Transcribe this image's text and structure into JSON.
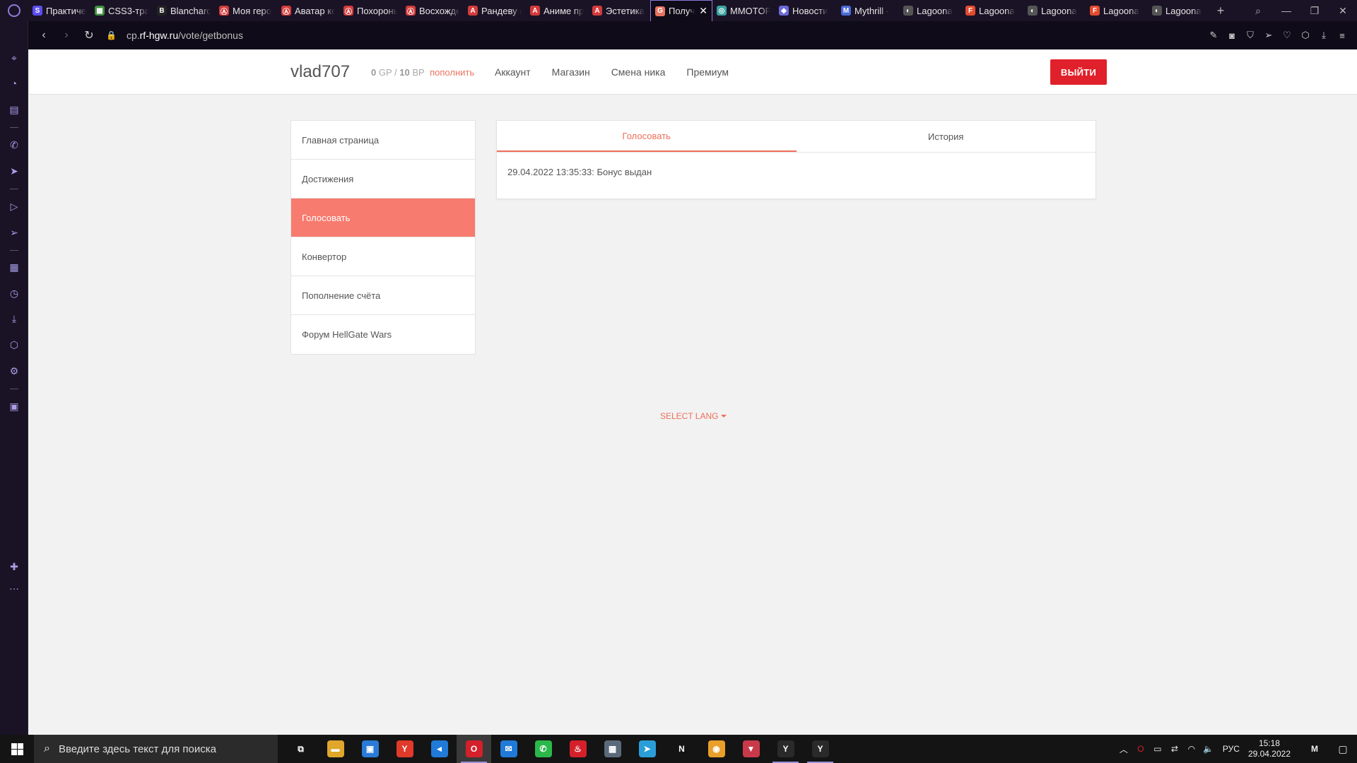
{
  "browser": {
    "tabs": [
      {
        "label": "Практиче",
        "favicon": "S",
        "color": "#5b4ef0"
      },
      {
        "label": "CSS3-тра",
        "favicon": "▦",
        "color": "#3c8f3c"
      },
      {
        "label": "Blanchard",
        "favicon": "B",
        "color": "#222222"
      },
      {
        "label": "Моя геро",
        "favicon": "Ⓐ",
        "color": "#d33a3a"
      },
      {
        "label": "Аватар ко",
        "favicon": "Ⓐ",
        "color": "#d33a3a"
      },
      {
        "label": "Похороны",
        "favicon": "Ⓐ",
        "color": "#d33a3a"
      },
      {
        "label": "Восхожде",
        "favicon": "Ⓐ",
        "color": "#d33a3a"
      },
      {
        "label": "Рандеву с",
        "favicon": "A",
        "color": "#d33a3a"
      },
      {
        "label": "Аниме пр",
        "favicon": "A",
        "color": "#d33a3a"
      },
      {
        "label": "Эстетика",
        "favicon": "A",
        "color": "#d33a3a"
      },
      {
        "label": "Получ",
        "favicon": "G",
        "color": "#e8735f",
        "active": true
      },
      {
        "label": "MMOTOP",
        "favicon": "◎",
        "color": "#3aa3a3"
      },
      {
        "label": "Новости",
        "favicon": "◆",
        "color": "#6a6ad8"
      },
      {
        "label": "Mythrill -",
        "favicon": "M",
        "color": "#4a6ad8"
      },
      {
        "label": "Lagoona",
        "favicon": "◐",
        "color": "#555555"
      },
      {
        "label": "Lagoona",
        "favicon": "F",
        "color": "#e34a2e"
      },
      {
        "label": "Lagoona",
        "favicon": "◐",
        "color": "#555555"
      },
      {
        "label": "Lagoona",
        "favicon": "F",
        "color": "#e34a2e"
      },
      {
        "label": "Lagoona",
        "favicon": "◐",
        "color": "#555555"
      }
    ],
    "close_glyph": "✕",
    "new_tab_glyph": "+",
    "url_host_prefix": "cp.",
    "url_host_main": "rf-hgw.ru",
    "url_path": "/vote/getbonus"
  },
  "site": {
    "username": "vlad707",
    "balance_gp_value": "0",
    "balance_gp_unit": "GP",
    "balance_sep": "/",
    "balance_bp_value": "10",
    "balance_bp_unit": "BP",
    "topup_link": "пополнить",
    "nav": [
      "Аккаунт",
      "Магазин",
      "Смена ника",
      "Премиум"
    ],
    "logout_label": "ВЫЙТИ",
    "menu": [
      "Главная страница",
      "Достижения",
      "Голосовать",
      "Конвертор",
      "Пополнение счёта",
      "Форум HellGate Wars"
    ],
    "active_menu_index": 2,
    "panel_tabs": [
      "Голосовать",
      "История"
    ],
    "panel_message": "29.04.2022 13:35:33: Бонус выдан",
    "select_lang": "SELECT LANG",
    "accent_color": "#f77b6e",
    "logout_color": "#e0202a"
  },
  "taskbar": {
    "search_placeholder": "Введите здесь текст для поиска",
    "apps": [
      {
        "name": "task-view",
        "glyph": "⧉",
        "color": "#141414"
      },
      {
        "name": "file-explorer",
        "glyph": "▬",
        "color": "#e0a72a"
      },
      {
        "name": "microsoft-store",
        "glyph": "▣",
        "color": "#2a7ad8"
      },
      {
        "name": "yandex-browser",
        "glyph": "Y",
        "color": "#e03a2a"
      },
      {
        "name": "vscode",
        "glyph": "◄",
        "color": "#1f7ad8"
      },
      {
        "name": "opera",
        "glyph": "O",
        "color": "#d4202a"
      },
      {
        "name": "mail",
        "glyph": "✉",
        "color": "#1f7ad8"
      },
      {
        "name": "whatsapp",
        "glyph": "✆",
        "color": "#2ab84a"
      },
      {
        "name": "app-red",
        "glyph": "♨",
        "color": "#d4202a"
      },
      {
        "name": "calculator",
        "glyph": "▦",
        "color": "#5a6a7a"
      },
      {
        "name": "telegram",
        "glyph": "➤",
        "color": "#2a9ed8"
      },
      {
        "name": "notion",
        "glyph": "N",
        "color": "#141414"
      },
      {
        "name": "app-orange",
        "glyph": "◉",
        "color": "#e8a02a"
      },
      {
        "name": "app-triangle",
        "glyph": "▼",
        "color": "#c83a4a"
      },
      {
        "name": "game-1",
        "glyph": "Y",
        "color": "#2a2a2a"
      },
      {
        "name": "game-2",
        "glyph": "Y",
        "color": "#2a2a2a"
      }
    ],
    "lang": "РУС",
    "time": "15:18",
    "date": "29.04.2022"
  }
}
